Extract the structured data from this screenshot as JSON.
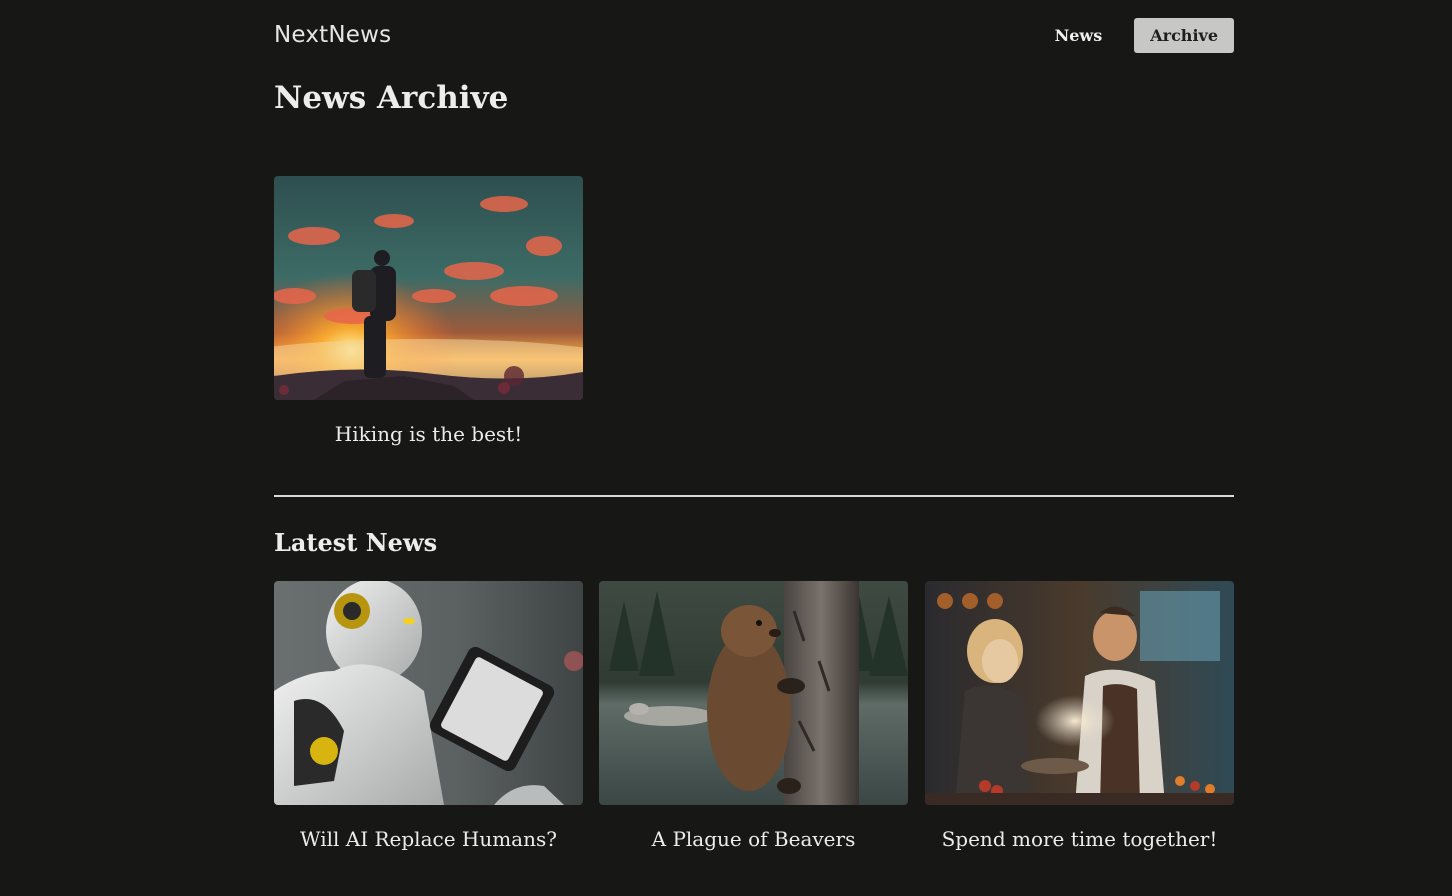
{
  "header": {
    "logo": "NextNews",
    "nav": [
      {
        "label": "News"
      },
      {
        "label": "Archive"
      }
    ]
  },
  "archive": {
    "title": "News Archive",
    "items": [
      {
        "title": "Hiking is the best!"
      }
    ]
  },
  "latest": {
    "title": "Latest News",
    "items": [
      {
        "title": "Will AI Replace Humans?"
      },
      {
        "title": "A Plague of Beavers"
      },
      {
        "title": "Spend more time together!"
      }
    ]
  }
}
